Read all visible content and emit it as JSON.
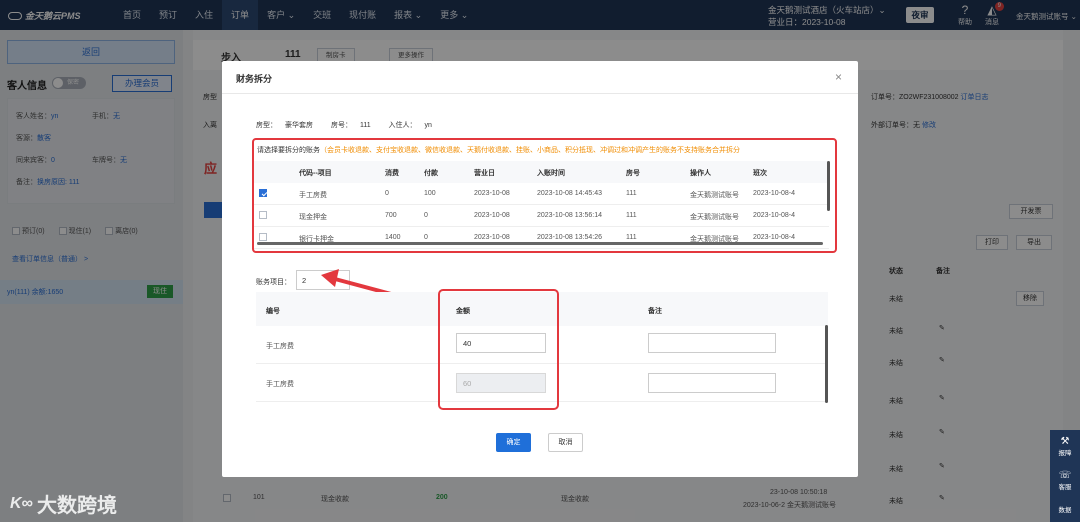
{
  "topbar": {
    "logo": "金天鹅云PMS",
    "nav": [
      "首页",
      "预订",
      "入住",
      "订单",
      "客户 ⌄",
      "交班",
      "现付账",
      "报表 ⌄",
      "更多 ⌄"
    ],
    "hotel_name": "金天鹅测试酒店（火车站店）⌄",
    "business_date": "营业日：2023-10-08",
    "night_audit": "夜审",
    "help": "帮助",
    "messages": "消息",
    "message_count": "9",
    "user": "金天鹅测试账号 ⌄"
  },
  "left": {
    "back": "返回",
    "guest_info": "客人信息",
    "secret_toggle": "保密",
    "member_btn": "办理会员",
    "name_label": "客人姓名：",
    "name": "yn",
    "phone_label": "手机：",
    "phone": "无",
    "source_label": "客源：",
    "source": "散客",
    "companions_label": "同来宾客：",
    "companions": "0",
    "plate_label": "车牌号：",
    "plate": "无",
    "remark_label": "备注：",
    "remark": "换房原因: 111",
    "chk_reserve": "预订(0)",
    "chk_live": "现住(1)",
    "chk_leave": "离店(0)",
    "view_order": "查看订单信息（普通） >",
    "room_entry": "yn(111)  余额:1650",
    "status_now": "现住"
  },
  "main": {
    "title": "步入",
    "room": "111",
    "btn_card": "制房卡",
    "btn_more": "更多操作",
    "room_type_prefix": "房型",
    "checkout_prefix": "入离",
    "order_no": "订单号：ZO2WF231008002",
    "order_log": "订单日志",
    "ext_order": "外部订单号：无",
    "ext_edit": "修改",
    "red_text": "应",
    "btn_invoice": "开发票",
    "btn_print": "打印",
    "btn_export": "导出",
    "col_status": "状态",
    "col_remark": "备注",
    "status_vals": [
      "未结",
      "未结",
      "未结",
      "未结",
      "未结",
      "未结",
      "未结",
      "未结"
    ],
    "remove_btn": "移除",
    "bottom_row": {
      "code": "101",
      "item": "现金收款",
      "amount": "200",
      "pay": "现金收款",
      "time": "23-10-08 10:50:18"
    },
    "bottom_row2": "2023-10-06-2 金天鹅测试账号"
  },
  "modal": {
    "title": "财务拆分",
    "close": "×",
    "room_type_label": "房型：",
    "room_type": "豪华套房",
    "room_no_label": "房号：",
    "room_no": "111",
    "guest_label": "入住人：",
    "guest": "yn",
    "notice_prefix": "请选择要拆分的账务",
    "notice_note": "（会员卡收退款、支付宝收退款、微信收退款、天鹅付收退款、挂账、小商品、积分抵现、冲调过和冲调产生的账务不支持账务合并拆分",
    "table1": {
      "headers": [
        "代码--项目",
        "消费",
        "付款",
        "营业日",
        "入账时间",
        "房号",
        "操作人",
        "班次"
      ],
      "rows": [
        {
          "checked": true,
          "cells": [
            "手工房费",
            "0",
            "100",
            "2023-10-08",
            "2023-10-08 14:45:43",
            "111",
            "金天鹅测试账号",
            "2023-10-08-4"
          ]
        },
        {
          "checked": false,
          "cells": [
            "现金押金",
            "700",
            "0",
            "2023-10-08",
            "2023-10-08 13:56:14",
            "111",
            "金天鹅测试账号",
            "2023-10-08-4"
          ]
        },
        {
          "checked": false,
          "cells": [
            "银行卡押金",
            "1400",
            "0",
            "2023-10-08",
            "2023-10-08 13:54:26",
            "111",
            "金天鹅测试账号",
            "2023-10-08-4"
          ]
        }
      ]
    },
    "account_items_label": "账务项目：",
    "account_items_value": "2",
    "table2": {
      "headers": [
        "编号",
        "金额",
        "备注"
      ],
      "rows": [
        {
          "label": "手工房费",
          "amount": "40",
          "disabled": false
        },
        {
          "label": "手工房费",
          "amount": "60",
          "disabled": true
        }
      ]
    },
    "ok": "确定",
    "cancel": "取消"
  },
  "dock": {
    "report": "报障",
    "service": "客服",
    "data": "数据"
  },
  "watermark": "大数跨境"
}
